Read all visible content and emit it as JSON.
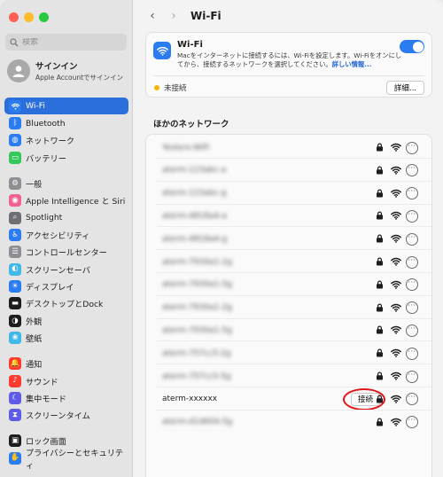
{
  "sidebar": {
    "search_placeholder": "検索",
    "signin": {
      "title": "サインイン",
      "subtitle": "Apple Accountでサインイン"
    },
    "items": [
      {
        "label": "Wi-Fi",
        "icon": "wifi-icon",
        "color": "#2b7cf0",
        "active": true
      },
      {
        "label": "Bluetooth",
        "icon": "bluetooth-icon",
        "color": "#2b7cf0"
      },
      {
        "label": "ネットワーク",
        "icon": "globe-icon",
        "color": "#2b7cf0"
      },
      {
        "label": "バッテリー",
        "icon": "battery-icon",
        "color": "#34c759"
      },
      {
        "label": "一般",
        "icon": "gear-icon",
        "color": "#8e8e93"
      },
      {
        "label": "Apple Intelligence と Siri",
        "icon": "siri-icon",
        "color": "#f06292"
      },
      {
        "label": "Spotlight",
        "icon": "search-icon",
        "color": "#6e6e73"
      },
      {
        "label": "アクセシビリティ",
        "icon": "accessibility-icon",
        "color": "#2b7cf0"
      },
      {
        "label": "コントロールセンター",
        "icon": "control-center-icon",
        "color": "#8e8e93"
      },
      {
        "label": "スクリーンセーバ",
        "icon": "screensaver-icon",
        "color": "#40b8e8"
      },
      {
        "label": "ディスプレイ",
        "icon": "display-icon",
        "color": "#2b7cf0"
      },
      {
        "label": "デスクトップとDock",
        "icon": "dock-icon",
        "color": "#1d1d1f"
      },
      {
        "label": "外観",
        "icon": "appearance-icon",
        "color": "#1d1d1f"
      },
      {
        "label": "壁紙",
        "icon": "wallpaper-icon",
        "color": "#40b8e8"
      },
      {
        "label": "通知",
        "icon": "bell-icon",
        "color": "#ff3b30"
      },
      {
        "label": "サウンド",
        "icon": "speaker-icon",
        "color": "#ff3b30"
      },
      {
        "label": "集中モード",
        "icon": "moon-icon",
        "color": "#5e5ce6"
      },
      {
        "label": "スクリーンタイム",
        "icon": "hourglass-icon",
        "color": "#5e5ce6"
      },
      {
        "label": "ロック画面",
        "icon": "lock-screen-icon",
        "color": "#1d1d1f"
      },
      {
        "label": "プライバシーとセキュリティ",
        "icon": "hand-icon",
        "color": "#2b7cf0"
      }
    ]
  },
  "header": {
    "title": "Wi-Fi"
  },
  "wifi": {
    "title": "Wi-Fi",
    "description": "Macをインターネットに接続するには、Wi-Fiを設定します。Wi-Fiをオンにしてから、接続するネットワークを選択してください。",
    "more_info": "詳しい情報...",
    "enabled": true,
    "status": "未接続",
    "details_button": "詳細..."
  },
  "networks": {
    "section_title": "ほかのネットワーク",
    "connect_label": "接続",
    "items": [
      {
        "name": "Yesterx-WiFi",
        "blurred": true
      },
      {
        "name": "aterm-123abc-a",
        "blurred": true
      },
      {
        "name": "aterm-123abc-g",
        "blurred": true
      },
      {
        "name": "aterm-4818a4-a",
        "blurred": true
      },
      {
        "name": "aterm-4818a4-g",
        "blurred": true
      },
      {
        "name": "aterm-7930a1-2g",
        "blurred": true
      },
      {
        "name": "aterm-7930a1-5g",
        "blurred": true
      },
      {
        "name": "aterm-7930a1-2g",
        "blurred": true
      },
      {
        "name": "aterm-7930a1-5g",
        "blurred": true
      },
      {
        "name": "aterm-757cc5-2g",
        "blurred": true
      },
      {
        "name": "aterm-757cc5-5g",
        "blurred": true
      },
      {
        "name": "aterm-xxxxxx",
        "blurred": false,
        "connect": true
      },
      {
        "name": "aterm-d14604-5g",
        "blurred": true
      }
    ]
  }
}
